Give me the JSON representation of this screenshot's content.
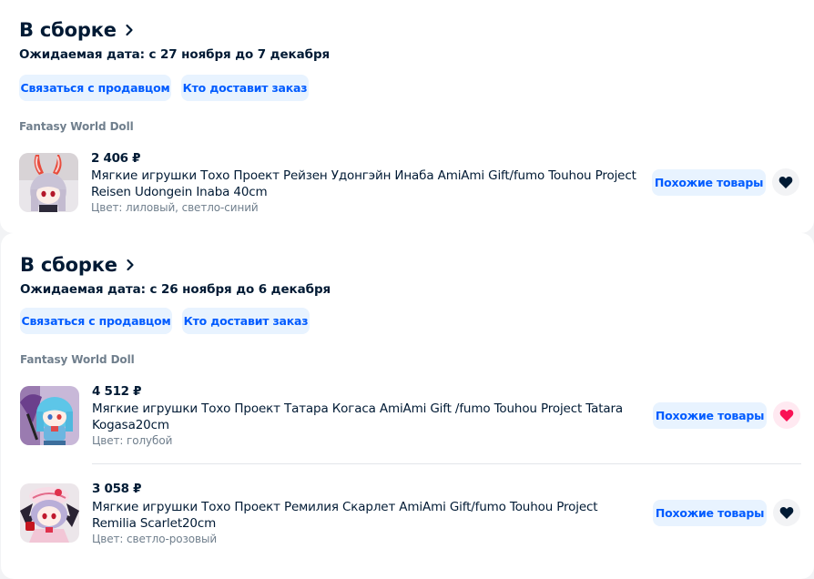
{
  "orders": [
    {
      "status": "В сборке",
      "expected_date": "Ожидаемая дата: с 27 ноября до 7 декабря",
      "contact_label": "Связаться с продавцом",
      "delivery_label": "Кто доставит заказ",
      "seller": "Fantasy World Doll",
      "items": [
        {
          "price": "2 406 ₽",
          "name": "Мягкие игрушки Тохо Проект Рейзен Удонгэйн Инаба AmiAmi Gift/fumo Touhou Project Reisen Udongein Inaba 40cm",
          "color": "Цвет: лиловый, светло-синий",
          "similar_label": "Похожие товары",
          "favorite": "heart-icon-dark"
        }
      ]
    },
    {
      "status": "В сборке",
      "expected_date": "Ожидаемая дата: с 26 ноября до 6 декабря",
      "contact_label": "Связаться с продавцом",
      "delivery_label": "Кто доставит заказ",
      "seller": "Fantasy World Doll",
      "items": [
        {
          "price": "4 512 ₽",
          "name": "Мягкие игрушки Тохо Проект Татара Когаса AmiAmi Gift /fumo Touhou Project Tatara Kogasa20cm",
          "color": "Цвет: голубой",
          "similar_label": "Похожие товары",
          "favorite": "heart-icon-pink"
        },
        {
          "price": "3 058 ₽",
          "name": "Мягкие игрушки Тохо Проект Ремилия Скарлет AmiAmi Gift/fumo Touhou Project Remilia Scarlet20cm",
          "color": "Цвет: светло-розовый",
          "similar_label": "Похожие товары",
          "favorite": "heart-icon-dark"
        }
      ]
    }
  ],
  "colors": {
    "accent": "#005bff",
    "button_bg": "#e8f3ff",
    "text": "#001a34",
    "muted": "#707f8d",
    "favorite_active": "#f91155"
  }
}
